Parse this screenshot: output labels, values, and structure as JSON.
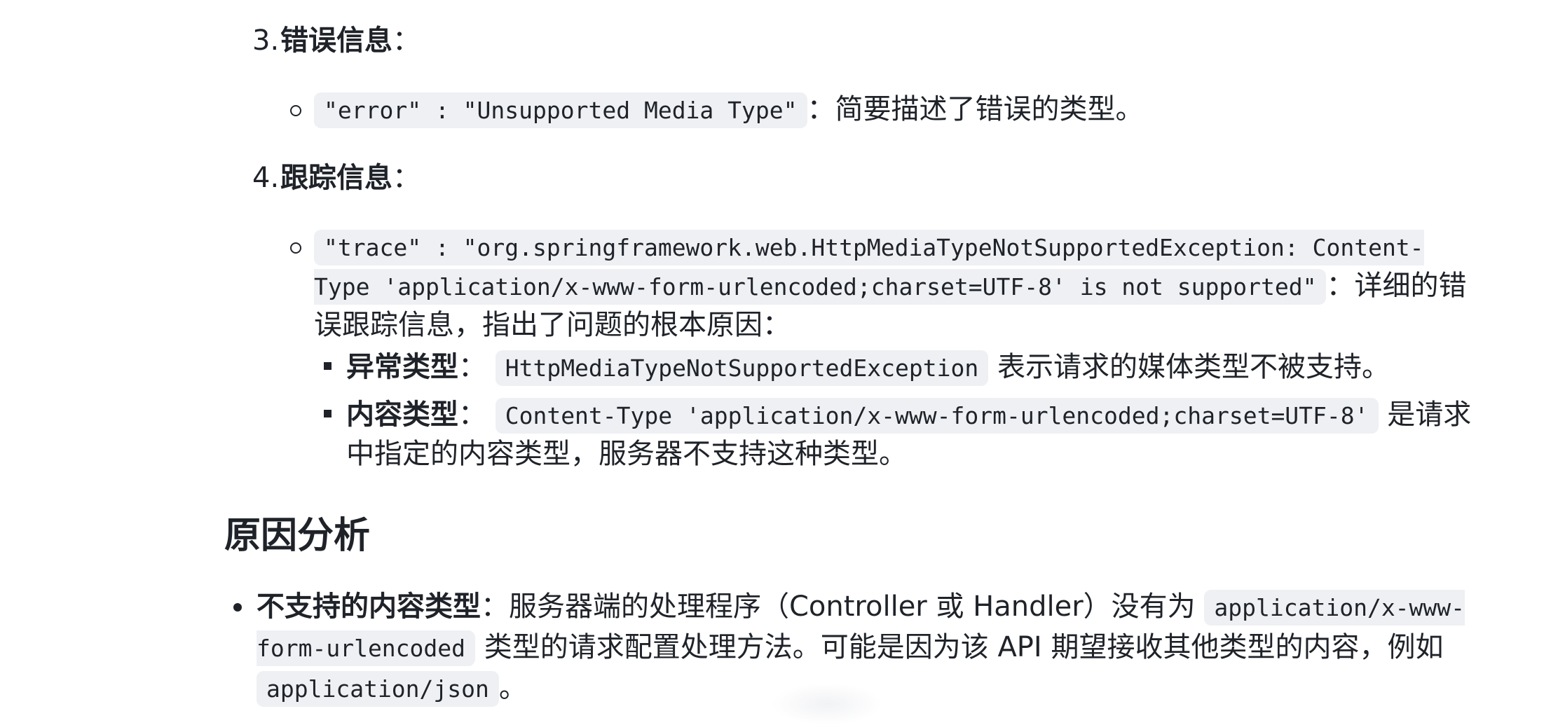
{
  "items": {
    "item3": {
      "number": "3.",
      "title": "错误信息",
      "colon": "：",
      "sub": {
        "code": "\"error\" : \"Unsupported Media Type\"",
        "text": "：简要描述了错误的类型。"
      }
    },
    "item4": {
      "number": "4.",
      "title": "跟踪信息",
      "colon": "：",
      "sub": {
        "code_part1": "\"trace\" : \"org.springframework.web.HttpMediaTypeNotSupportedException: Content-",
        "code_part2": "Type 'application/x-www-form-urlencoded;charset=UTF-8' is not supported\"",
        "text_part1": "：详细的错",
        "text_part2": "误跟踪信息，指出了问题的根本原因：",
        "bullets": [
          {
            "title": "异常类型",
            "colon": "：",
            "code": "HttpMediaTypeNotSupportedException",
            "text": "表示请求的媒体类型不被支持。"
          },
          {
            "title": "内容类型",
            "colon": "：",
            "code": "Content-Type 'application/x-www-form-urlencoded;charset=UTF-8'",
            "text_part1": "是请求",
            "text_part2": "中指定的内容类型，服务器不支持这种类型。"
          }
        ]
      }
    }
  },
  "analysis": {
    "heading": "原因分析",
    "bullet": {
      "title": "不支持的内容类型",
      "text1": "：服务器端的处理程序（Controller 或 Handler）没有为",
      "code1_part1": "application/x-www-",
      "code1_part2": "form-urlencoded",
      "text2": "类型的请求配置处理方法。可能是因为该 API 期望接收其他类型的内容，例如",
      "code2": "application/json",
      "text3": "。"
    }
  }
}
